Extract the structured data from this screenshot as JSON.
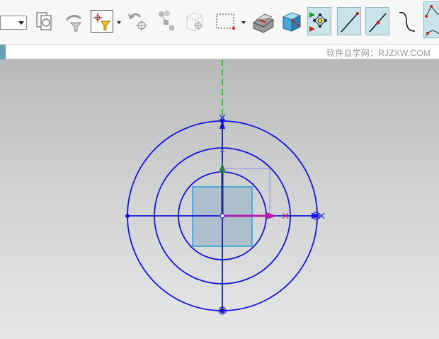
{
  "app": {
    "watermark": "软件自学网：RJZXW.COM"
  },
  "toolbar": {
    "combo_value": "",
    "buttons": [
      {
        "name": "layer-settings-icon"
      },
      {
        "name": "selection-filter-icon"
      },
      {
        "name": "snap-point-icon"
      },
      {
        "name": "undo-selection-icon"
      },
      {
        "name": "assembly-navigator-icon"
      },
      {
        "name": "wireframe-box-icon"
      },
      {
        "name": "rectangle-select-icon"
      },
      {
        "name": "shaded-part-icon"
      },
      {
        "name": "shaded-box-icon"
      },
      {
        "name": "dynamic-csys-icon",
        "active": true
      },
      {
        "name": "line-tool-icon",
        "active": true
      },
      {
        "name": "line-point-tool-icon",
        "active": true
      },
      {
        "name": "spline-tool-icon"
      },
      {
        "name": "studio-curve-icon",
        "active": true
      }
    ]
  },
  "colors": {
    "sketch_blue": "#1515d6",
    "datum_green": "#22cc22",
    "x_axis_magenta": "#b01fb0",
    "fill_square": "#a9bccc",
    "square_edge": "#2aa0e0"
  }
}
